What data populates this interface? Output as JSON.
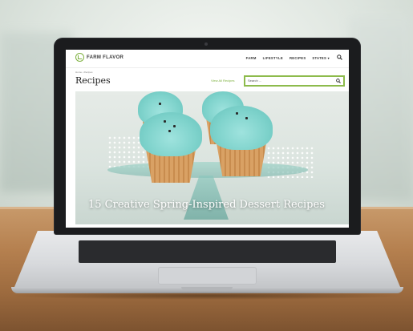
{
  "site": {
    "logo_text": "FARM FLAVOR",
    "menu": [
      "FARM",
      "LIFESTYLE",
      "RECIPES",
      "STATES"
    ],
    "states_caret": "▾"
  },
  "page": {
    "breadcrumb": "Home › Recipes",
    "title": "Recipes",
    "view_all": "View All Recipes",
    "search": {
      "placeholder": "Search ..."
    }
  },
  "hero": {
    "title": "15 Creative Spring-Inspired Dessert Recipes"
  },
  "colors": {
    "brand_green": "#7fb241",
    "search_border": "#8dbb4c",
    "frosting": "#7fd3cc"
  },
  "icons": [
    "search-icon",
    "logo-icon",
    "camera-icon"
  ]
}
